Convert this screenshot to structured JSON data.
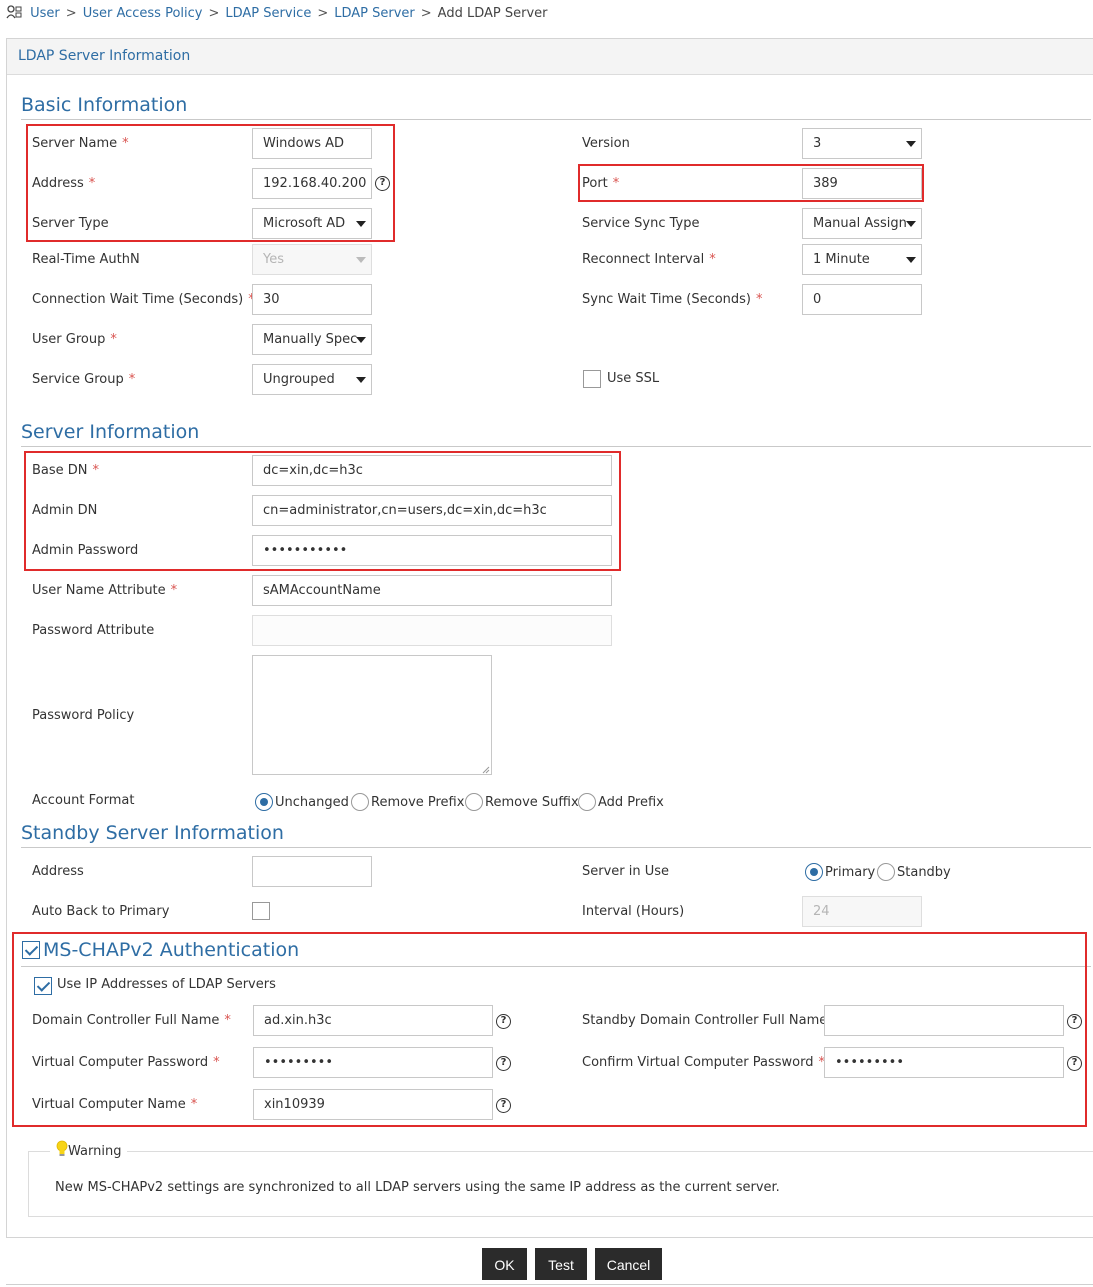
{
  "breadcrumb": {
    "items": [
      "User",
      "User Access Policy",
      "LDAP Service",
      "LDAP Server"
    ],
    "current": "Add LDAP Server",
    "separator": ">"
  },
  "panel_title": "LDAP Server Information",
  "basic": {
    "title": "Basic Information",
    "server_name": {
      "label": "Server Name",
      "value": "Windows AD"
    },
    "address": {
      "label": "Address",
      "value": "192.168.40.200"
    },
    "server_type": {
      "label": "Server Type",
      "value": "Microsoft AD"
    },
    "realtime_authn": {
      "label": "Real-Time AuthN",
      "value": "Yes"
    },
    "conn_wait": {
      "label": "Connection Wait Time (Seconds)",
      "value": "30"
    },
    "user_group": {
      "label": "User Group",
      "value": "Manually Spec"
    },
    "service_group": {
      "label": "Service Group",
      "value": "Ungrouped"
    },
    "version": {
      "label": "Version",
      "value": "3"
    },
    "port": {
      "label": "Port",
      "value": "389"
    },
    "sync_type": {
      "label": "Service Sync Type",
      "value": "Manual Assign"
    },
    "reconnect": {
      "label": "Reconnect Interval",
      "value": "1 Minute"
    },
    "sync_wait": {
      "label": "Sync Wait Time (Seconds)",
      "value": "0"
    },
    "use_ssl": {
      "label": "Use SSL"
    }
  },
  "server": {
    "title": "Server Information",
    "base_dn": {
      "label": "Base DN",
      "value": "dc=xin,dc=h3c"
    },
    "admin_dn": {
      "label": "Admin DN",
      "value": "cn=administrator,cn=users,dc=xin,dc=h3c"
    },
    "admin_password": {
      "label": "Admin Password",
      "value": "•••••••••••"
    },
    "username_attr": {
      "label": "User Name Attribute",
      "value": "sAMAccountName"
    },
    "password_attr": {
      "label": "Password Attribute",
      "value": ""
    },
    "password_policy": {
      "label": "Password Policy",
      "value": ""
    },
    "account_format": {
      "label": "Account Format",
      "options": [
        "Unchanged",
        "Remove Prefix",
        "Remove Suffix",
        "Add Prefix"
      ],
      "selected": "Unchanged"
    }
  },
  "standby": {
    "title": "Standby Server Information",
    "address": {
      "label": "Address",
      "value": ""
    },
    "auto_back": {
      "label": "Auto Back to Primary"
    },
    "server_in_use": {
      "label": "Server in Use",
      "options": [
        "Primary",
        "Standby"
      ],
      "selected": "Primary"
    },
    "interval": {
      "label": "Interval (Hours)",
      "value": "24"
    }
  },
  "mschap": {
    "title": "MS-CHAPv2 Authentication",
    "use_ip": {
      "label": "Use IP Addresses of LDAP Servers"
    },
    "dc_full_name": {
      "label": "Domain Controller Full Name",
      "value": "ad.xin.h3c"
    },
    "vc_password": {
      "label": "Virtual Computer Password",
      "value": "•••••••••"
    },
    "vc_name": {
      "label": "Virtual Computer Name",
      "value": "xin10939"
    },
    "standby_dc": {
      "label": "Standby Domain Controller Full Name",
      "value": ""
    },
    "confirm_vc_password": {
      "label": "Confirm Virtual Computer Password",
      "value": "•••••••••"
    }
  },
  "warning": {
    "title": "Warning",
    "text": "New MS-CHAPv2 settings are synchronized to all LDAP servers using the same IP address as the current server."
  },
  "buttons": {
    "ok": "OK",
    "test": "Test",
    "cancel": "Cancel"
  },
  "colors": {
    "accent": "#2e6da4",
    "required": "#d9534f",
    "highlight": "#e02b2b",
    "button": "#2b2b2b"
  }
}
